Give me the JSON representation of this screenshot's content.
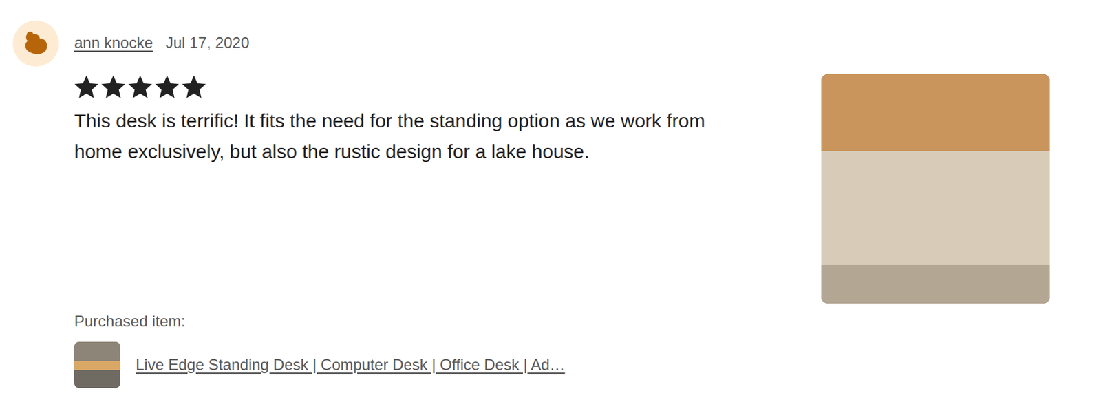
{
  "review": {
    "reviewer": "ann knocke",
    "date": "Jul 17, 2020",
    "stars": 5,
    "text": "This desk is terrific! It fits the need for the standing option as we work from home exclusively, but also the rustic design for a lake house.",
    "purchased_label": "Purchased item:",
    "item_title": "Live Edge Standing Desk | Computer Desk | Office Desk | Ad…"
  }
}
